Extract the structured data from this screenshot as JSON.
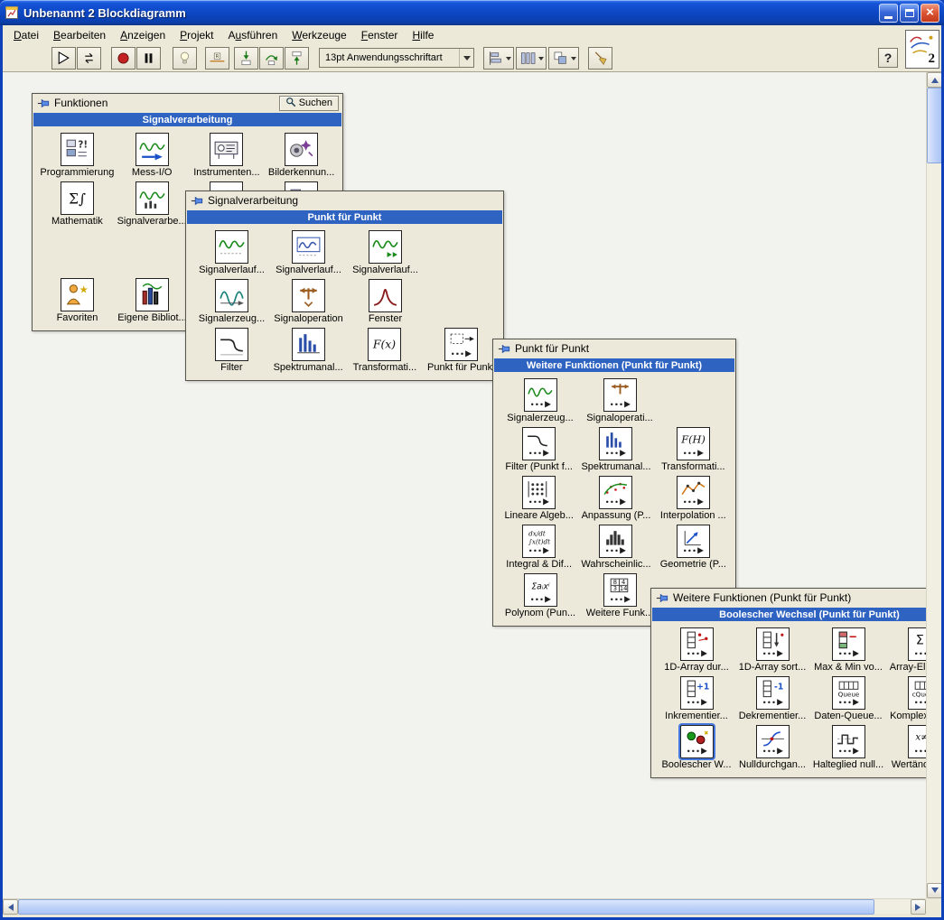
{
  "window": {
    "title": "Unbenannt 2 Blockdiagramm",
    "vi_badge": "2"
  },
  "menu": {
    "items": [
      {
        "label": "Datei",
        "key": "D"
      },
      {
        "label": "Bearbeiten",
        "key": "B"
      },
      {
        "label": "Anzeigen",
        "key": "A"
      },
      {
        "label": "Projekt",
        "key": "P"
      },
      {
        "label": "Ausführen",
        "key": "u"
      },
      {
        "label": "Werkzeuge",
        "key": "W"
      },
      {
        "label": "Fenster",
        "key": "F"
      },
      {
        "label": "Hilfe",
        "key": "H"
      }
    ]
  },
  "toolbar": {
    "buttons": [
      {
        "name": "run-button",
        "icon": "run-arrow-icon"
      },
      {
        "name": "run-continuous-button",
        "icon": "run-continuous-icon"
      },
      {
        "name": "abort-button",
        "icon": "abort-icon"
      },
      {
        "name": "pause-button",
        "icon": "pause-icon"
      },
      {
        "name": "highlight-execution-button",
        "icon": "lightbulb-icon"
      },
      {
        "name": "retain-wire-values-button",
        "icon": "retain-wire-values-icon"
      },
      {
        "name": "step-into-button",
        "icon": "step-into-icon"
      },
      {
        "name": "step-over-button",
        "icon": "step-over-icon"
      },
      {
        "name": "step-out-button",
        "icon": "step-out-icon"
      }
    ],
    "font_selector": "13pt Anwendungsschriftart",
    "dropdowns": [
      {
        "name": "align-objects-dropdown",
        "icon": "align-objects-icon"
      },
      {
        "name": "distribute-objects-dropdown",
        "icon": "distribute-objects-icon"
      },
      {
        "name": "reorder-objects-dropdown",
        "icon": "reorder-objects-icon"
      }
    ],
    "cleanup": {
      "name": "cleanup-diagram-button",
      "icon": "cleanup-diagram-icon"
    },
    "help_label": "?"
  },
  "palettes": [
    {
      "id": "funktionen",
      "title": "Funktionen",
      "search_label": "Suchen",
      "category_header": "Signalverarbeitung",
      "rows": [
        {
          "items": [
            {
              "label": "Programmierung",
              "icon": "programming-palette-icon"
            },
            {
              "label": "Mess-I/O",
              "icon": "measurement-io-icon"
            },
            {
              "label": "Instrumenten...",
              "icon": "instrument-io-icon"
            },
            {
              "label": "Bilderkennun...",
              "icon": "vision-motion-icon"
            }
          ]
        },
        {
          "items": [
            {
              "label": "Mathematik",
              "icon": "mathematics-icon"
            },
            {
              "label": "Signalverarbe...",
              "icon": "signal-processing-icon"
            },
            {
              "label": "",
              "icon": "data-communication-icon"
            },
            {
              "label": "",
              "icon": "connectivity-icon"
            }
          ]
        },
        {
          "spacer": true
        },
        {
          "items": [
            {
              "label": "Favoriten",
              "icon": "favorites-icon"
            },
            {
              "label": "Eigene Bibliot...",
              "icon": "user-libraries-icon"
            }
          ]
        }
      ]
    },
    {
      "id": "signalverarbeitung",
      "title": "Signalverarbeitung",
      "category_header": "Punkt für Punkt",
      "rows": [
        {
          "items": [
            {
              "label": "Signalverlauf...",
              "icon": "waveform-generation-icon"
            },
            {
              "label": "Signalverlauf...",
              "icon": "waveform-conditioning-icon"
            },
            {
              "label": "Signalverlauf...",
              "icon": "waveform-measurements-icon"
            }
          ]
        },
        {
          "items": [
            {
              "label": "Signalerzeug...",
              "icon": "signal-generation-icon"
            },
            {
              "label": "Signaloperation",
              "icon": "signal-operation-icon"
            },
            {
              "label": "Fenster",
              "icon": "window-function-icon"
            }
          ]
        },
        {
          "items": [
            {
              "label": "Filter",
              "icon": "filter-icon"
            },
            {
              "label": "Spektrumanal...",
              "icon": "spectral-analysis-icon"
            },
            {
              "label": "Transformati...",
              "icon": "transforms-icon"
            },
            {
              "label": "Punkt für Punkt",
              "icon": "point-by-point-icon"
            }
          ]
        }
      ]
    },
    {
      "id": "punkt-fuer-punkt",
      "title": "Punkt für Punkt",
      "category_header": "Weitere Funktionen (Punkt für Punkt)",
      "rows": [
        {
          "items": [
            {
              "label": "Signalerzeug...",
              "icon": "signal-generation-ptbypt-icon"
            },
            {
              "label": "Signaloperati...",
              "icon": "signal-operation-ptbypt-icon"
            }
          ]
        },
        {
          "items": [
            {
              "label": "Filter (Punkt f...",
              "icon": "filter-ptbypt-icon"
            },
            {
              "label": "Spektrumanal...",
              "icon": "spectral-ptbypt-icon"
            },
            {
              "label": "Transformati...",
              "icon": "transforms-ptbypt-icon"
            }
          ]
        },
        {
          "items": [
            {
              "label": "Lineare Algeb...",
              "icon": "linear-algebra-icon"
            },
            {
              "label": "Anpassung (P...",
              "icon": "fitting-icon"
            },
            {
              "label": "Interpolation ...",
              "icon": "interpolation-icon"
            }
          ]
        },
        {
          "items": [
            {
              "label": "Integral & Dif...",
              "icon": "integral-derivative-icon"
            },
            {
              "label": "Wahrscheinlic...",
              "icon": "probability-icon"
            },
            {
              "label": "Geometrie (P...",
              "icon": "geometry-icon"
            }
          ]
        },
        {
          "items": [
            {
              "label": "Polynom (Pun...",
              "icon": "polynomial-icon"
            },
            {
              "label": "Weitere Funk...",
              "icon": "other-functions-icon"
            }
          ]
        }
      ]
    },
    {
      "id": "weitere-funktionen",
      "title": "Weitere Funktionen (Punkt für Punkt)",
      "category_header": "Boolescher Wechsel (Punkt für Punkt)",
      "rows": [
        {
          "items": [
            {
              "label": "1D-Array dur...",
              "icon": "array-search-icon"
            },
            {
              "label": "1D-Array sort...",
              "icon": "array-sort-icon"
            },
            {
              "label": "Max & Min vo...",
              "icon": "array-maxmin-icon"
            },
            {
              "label": "Array-Elemen...",
              "icon": "array-elements-icon"
            }
          ]
        },
        {
          "items": [
            {
              "label": "Inkrementier...",
              "icon": "increment-icon"
            },
            {
              "label": "Dekrementier...",
              "icon": "decrement-icon"
            },
            {
              "label": "Daten-Queue...",
              "icon": "data-queue-icon"
            },
            {
              "label": "Komplexe Qu...",
              "icon": "complex-queue-icon"
            }
          ]
        },
        {
          "items": [
            {
              "label": "Boolescher W...",
              "icon": "boolean-crossing-icon",
              "selected": true
            },
            {
              "label": "Nulldurchgan...",
              "icon": "zero-crossing-icon"
            },
            {
              "label": "Halteglied null...",
              "icon": "zero-hold-icon"
            },
            {
              "label": "Wertänderun...",
              "icon": "value-change-icon"
            }
          ]
        }
      ]
    }
  ]
}
